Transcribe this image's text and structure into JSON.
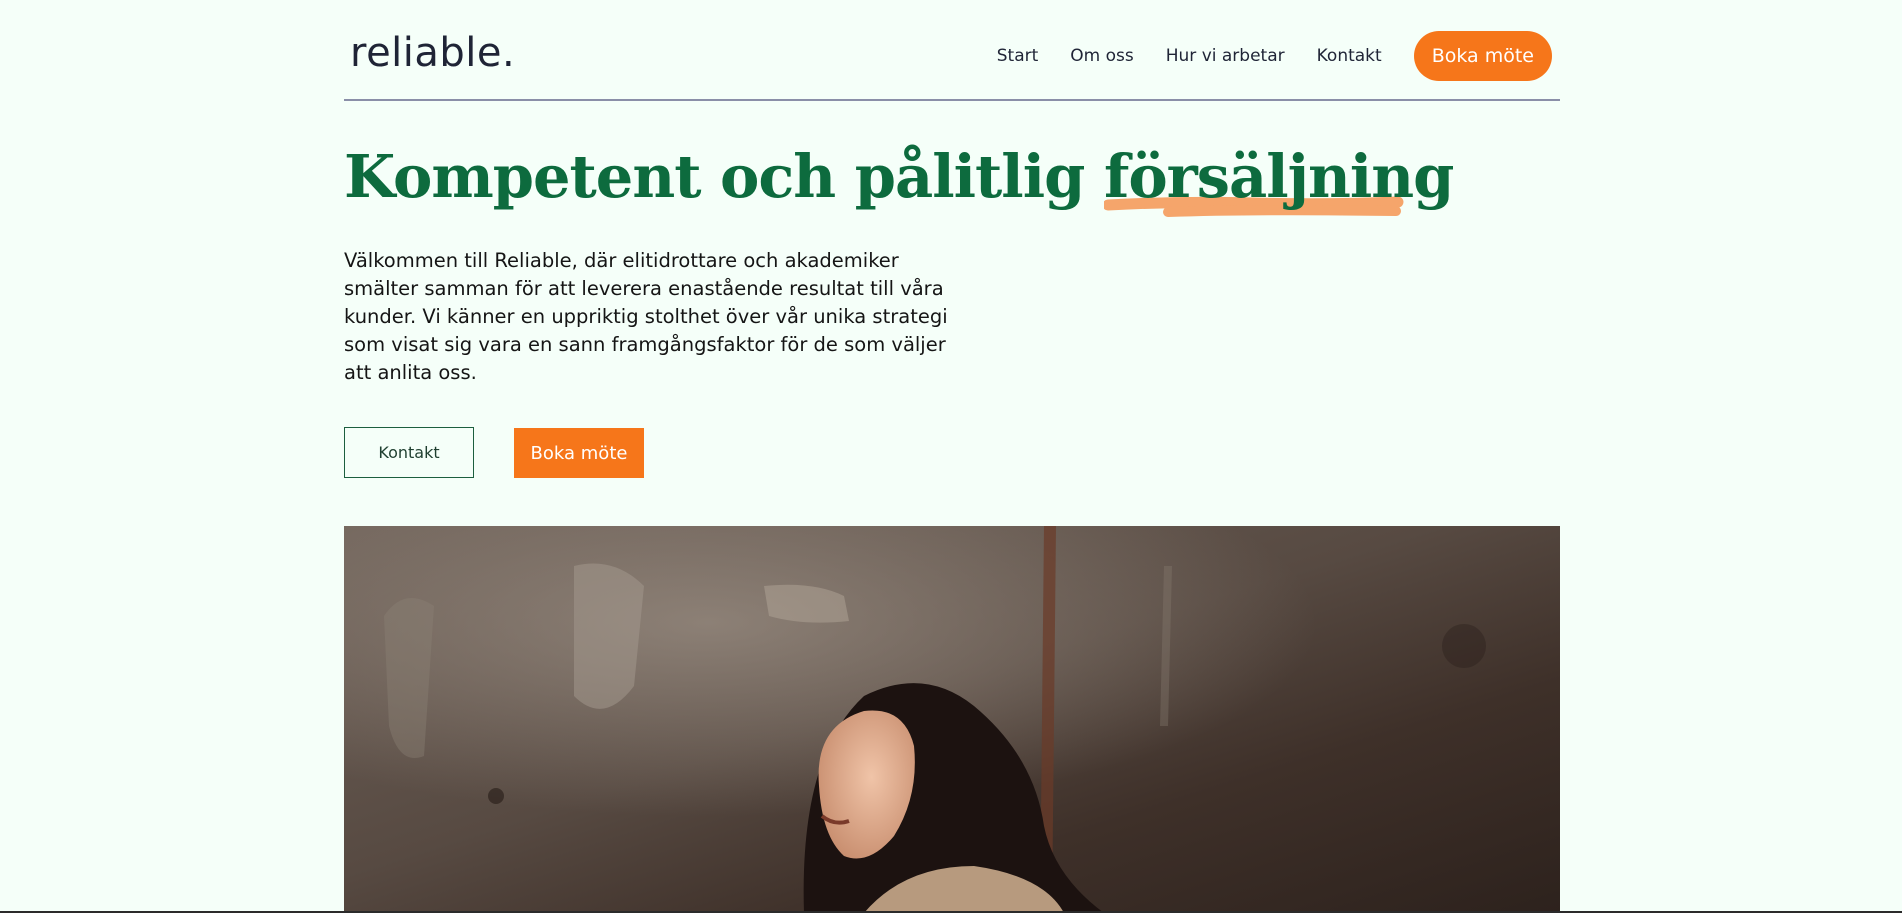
{
  "header": {
    "logo": "reliable.",
    "nav": [
      {
        "label": "Start"
      },
      {
        "label": "Om oss"
      },
      {
        "label": "Hur vi arbetar"
      },
      {
        "label": "Kontakt"
      }
    ],
    "cta_label": "Boka möte"
  },
  "hero": {
    "title_main": "Kompetent och pålitlig ",
    "title_highlight": "försäljning",
    "body": "Välkommen till Reliable, där elitidrottare och akademiker smälter samman för att leverera enastående resultat till våra kunder. Vi känner en uppriktig stolthet över vår unika strategi som visat sig vara en sann framgångsfaktor för de som väljer att anlita oss.",
    "secondary_button": "Kontakt",
    "primary_button": "Boka möte"
  },
  "colors": {
    "background": "#f5fff9",
    "heading_green": "#0d6b3e",
    "accent_orange": "#f6761a",
    "highlight_peach": "#f5a56b",
    "text_dark": "#1f2436"
  }
}
